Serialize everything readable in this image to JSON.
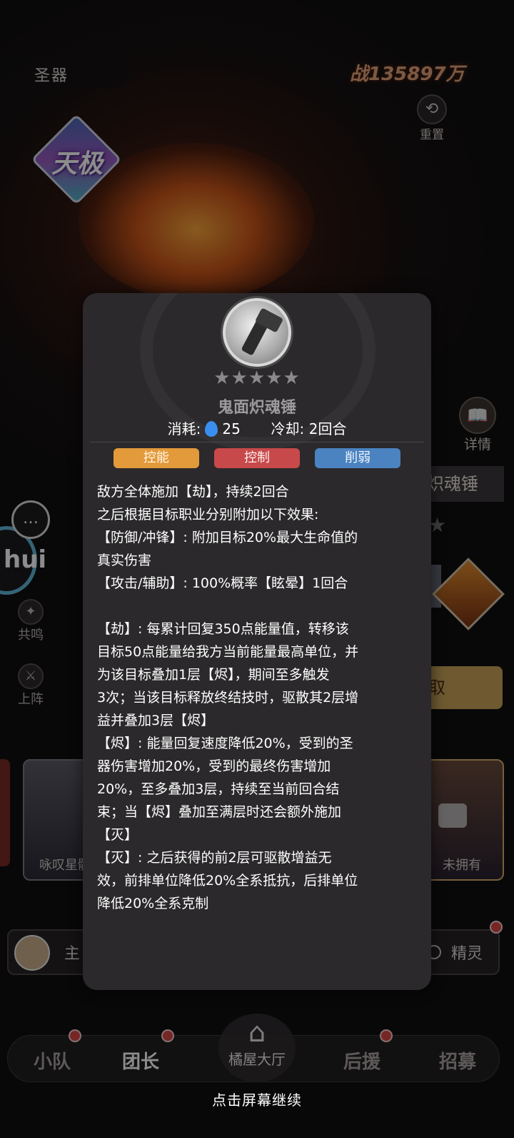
{
  "header": {
    "tab": "圣器",
    "power": "战135897万",
    "reset_label": "重置"
  },
  "badge": {
    "rank_text": "天极"
  },
  "right_panel": {
    "detail_label": "详情",
    "artifact_title_partial": "炽魂锤",
    "get_label": "取"
  },
  "left_panel": {
    "resonance_label": "共鸣",
    "deploy_label": "上阵",
    "hui_text": "hui"
  },
  "cards": [
    {
      "label": "咏叹星骸"
    },
    {
      "label": "未拥有"
    }
  ],
  "role_bar": {
    "left_label": "主",
    "right_label": "精灵"
  },
  "nav": {
    "items": [
      "小队",
      "团长",
      "后援",
      "招募"
    ],
    "home_label": "橘屋大厅",
    "active": "团长"
  },
  "continue_hint": "点击屏幕继续",
  "popup": {
    "stars": "★★★★★",
    "name": "鬼面炽魂锤",
    "cost_label": "消耗:",
    "cost_value": "25",
    "cooldown_label": "冷却:",
    "cooldown_value": "2回合",
    "tags": [
      "控能",
      "控制",
      "削弱"
    ],
    "lines": [
      "敌方全体施加【劫】，持续2回合",
      "之后根据目标职业分别附加以下效果:",
      "【防御/冲锋】: 附加目标20%最大生命值的",
      "真实伤害",
      "【攻击/辅助】: 100%概率【眩晕】1回合",
      "",
      "【劫】: 每累计回复350点能量值，转移该",
      "目标50点能量给我方当前能量最高单位，并",
      "为该目标叠加1层【烬】，期间至多触发",
      "3次；当该目标释放终结技时，驱散其2层增",
      "益并叠加3层【烬】",
      "【烬】: 能量回复速度降低20%，受到的圣",
      "器伤害增加20%，受到的最终伤害增加",
      "20%，至多叠加3层，持续至当前回合结",
      "束；当【烬】叠加至满层时还会额外施加",
      "【灭】",
      "【灭】: 之后获得的前2层可驱散增益无",
      "效，前排单位降低20%全系抵抗，后排单位",
      "降低20%全系克制"
    ]
  },
  "colors": {
    "tag_control_energy": "#e39a3a",
    "tag_control": "#c8494a",
    "tag_weaken": "#4a83c0",
    "power_text": "#e2a27a"
  }
}
